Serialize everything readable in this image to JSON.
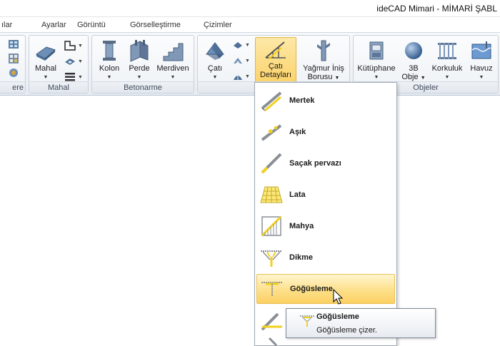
{
  "window": {
    "title": "ideCAD Mimari - MİMARİ ŞABL"
  },
  "tabs": [
    {
      "label": "ılar"
    },
    {
      "label": "Ayarlar"
    },
    {
      "label": "Görüntü"
    },
    {
      "label": "Görselleştirme"
    },
    {
      "label": "Çizimler"
    }
  ],
  "groups": {
    "partial": "ere",
    "mahal": "Mahal",
    "betonarme": "Betonarme",
    "objeler": "Objeler"
  },
  "buttons": {
    "mahal": "Mahal",
    "kolon": "Kolon",
    "perde": "Perde",
    "merdiven": "Merdiven",
    "cati": "Çatı",
    "cati_detaylari_line1": "Çatı",
    "cati_detaylari_line2": "Detayları",
    "yagmur_line1": "Yağmur İniş",
    "yagmur_line2": "Borusu",
    "kutuphane": "Kütüphane",
    "obje3b_line1": "3B",
    "obje3b_line2": "Obje",
    "korkuluk": "Korkuluk",
    "havuz": "Havuz"
  },
  "dropdown_arrow": "▼",
  "menu": {
    "items": [
      {
        "label": "Mertek"
      },
      {
        "label": "Aşık"
      },
      {
        "label": "Saçak pervazı"
      },
      {
        "label": "Lata"
      },
      {
        "label": "Mahya"
      },
      {
        "label": "Dikme"
      },
      {
        "label": "Göğüsleme"
      }
    ],
    "hovered_index": 6
  },
  "tooltip": {
    "title": "Göğüsleme",
    "description": "Göğüsleme çizer."
  },
  "colors": {
    "accent_yellow": "#f2d01f",
    "hover_fill": "#fbd063",
    "ribbon_bg": "#eef2f6",
    "beam_gray": "#8a8f96"
  },
  "icons": {
    "mertek": "rafter-icon",
    "asik": "purlin-icon",
    "sacak": "eave-fascia-icon",
    "lata": "lath-icon",
    "mahya": "ridge-icon",
    "dikme": "post-icon",
    "gogusleme": "bracing-icon"
  }
}
